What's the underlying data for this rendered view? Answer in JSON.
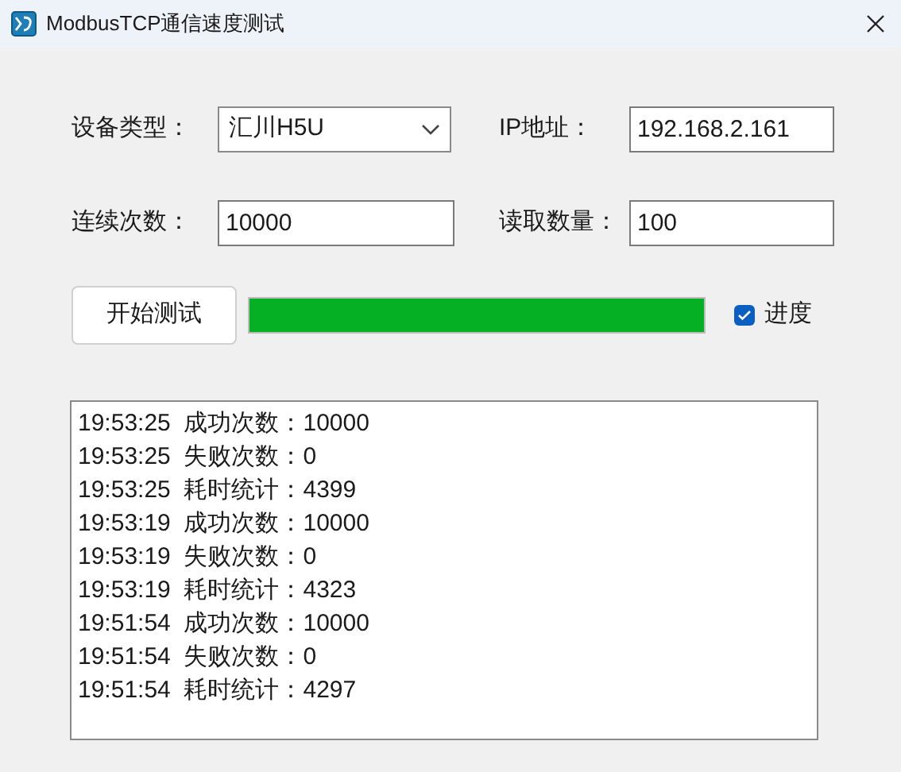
{
  "window": {
    "title": "ModbusTCP通信速度测试"
  },
  "fields": [
    {
      "label": "设备类型：",
      "kind": "combo",
      "value": "汇川H5U"
    },
    {
      "label": "IP地址：",
      "kind": "text",
      "value": "192.168.2.161"
    },
    {
      "label": "连续次数：",
      "kind": "text",
      "value": "10000"
    },
    {
      "label": "读取数量：",
      "kind": "text",
      "value": "100"
    }
  ],
  "start_button": "开始测试",
  "progress": {
    "level": 1.0
  },
  "progress_checkbox": {
    "label": "进度",
    "checked": true
  },
  "log": [
    "19:53:25  成功次数：10000",
    "19:53:25  失败次数：0",
    "19:53:25  耗时统计：4399",
    "19:53:19  成功次数：10000",
    "19:53:19  失败次数：0",
    "19:53:19  耗时统计：4323",
    "19:51:54  成功次数：10000",
    "19:51:54  失败次数：0",
    "19:51:54  耗时统计：4297"
  ]
}
